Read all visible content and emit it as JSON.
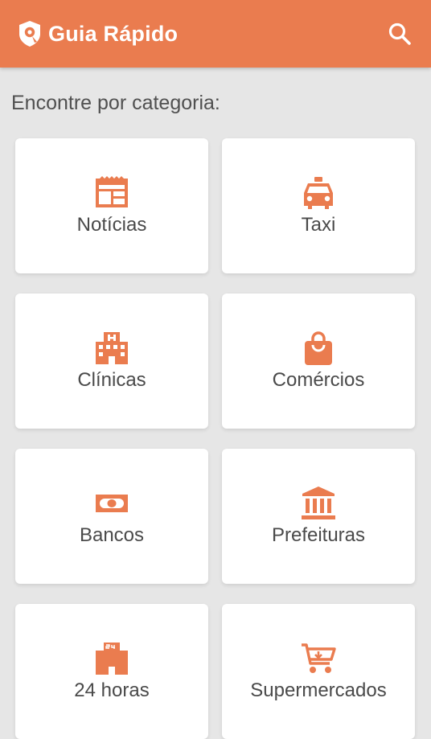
{
  "app": {
    "title": "Guia Rápido",
    "accent_color": "#ea7c4f",
    "logo_icon": "map-pin-shield-icon",
    "search_icon": "search-icon"
  },
  "main": {
    "heading": "Encontre por categoria:",
    "categories": [
      {
        "label": "Notícias",
        "icon": "newspaper-icon"
      },
      {
        "label": "Taxi",
        "icon": "taxi-icon"
      },
      {
        "label": "Clínicas",
        "icon": "hospital-icon"
      },
      {
        "label": "Comércios",
        "icon": "shopping-bag-icon"
      },
      {
        "label": "Bancos",
        "icon": "cash-icon"
      },
      {
        "label": "Prefeituras",
        "icon": "city-hall-icon"
      },
      {
        "label": "24 horas",
        "icon": "store-24h-icon"
      },
      {
        "label": "Supermercados",
        "icon": "shopping-cart-icon"
      }
    ]
  }
}
